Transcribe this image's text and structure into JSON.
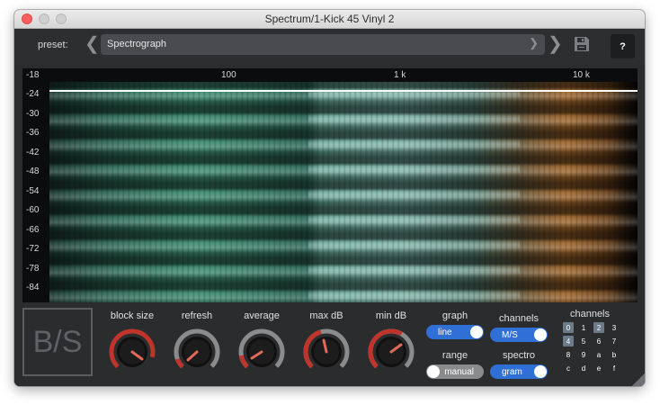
{
  "window": {
    "title": "Spectrum/1-Kick 45 Vinyl 2"
  },
  "header": {
    "preset_label": "preset:",
    "preset_value": "Spectrograph",
    "help_label": "?"
  },
  "spectrum": {
    "freq_labels": [
      "100",
      "1 k",
      "10 k"
    ],
    "db_labels": [
      "-18",
      "-24",
      "-30",
      "-36",
      "-42",
      "-48",
      "-54",
      "-60",
      "-66",
      "-72",
      "-78",
      "-84"
    ]
  },
  "logo": {
    "text": "B/S"
  },
  "knobs": [
    {
      "label": "block size"
    },
    {
      "label": "refresh"
    },
    {
      "label": "average"
    },
    {
      "label": "max dB"
    },
    {
      "label": "min dB"
    }
  ],
  "toggles": {
    "graph": {
      "label": "graph",
      "value": "line"
    },
    "range": {
      "label": "range",
      "value": "manual"
    },
    "channels": {
      "label": "channels",
      "value": "M/S"
    },
    "spectro": {
      "label": "spectro",
      "value": "gram"
    }
  },
  "channels": {
    "label": "channels",
    "cells": [
      "0",
      "1",
      "2",
      "3",
      "4",
      "5",
      "6",
      "7",
      "8",
      "9",
      "a",
      "b",
      "c",
      "d",
      "e",
      "f"
    ],
    "active": [
      "0",
      "2",
      "4"
    ]
  },
  "colors": {
    "accent": "#2f6fd6",
    "knob_indicator": "#e06a5a",
    "knob_ring_active": "#c0352b"
  },
  "icons": {
    "save": "save-icon",
    "prev": "chevron-left-icon",
    "next": "chevron-right-icon",
    "dropdown": "chevron-down-icon"
  }
}
